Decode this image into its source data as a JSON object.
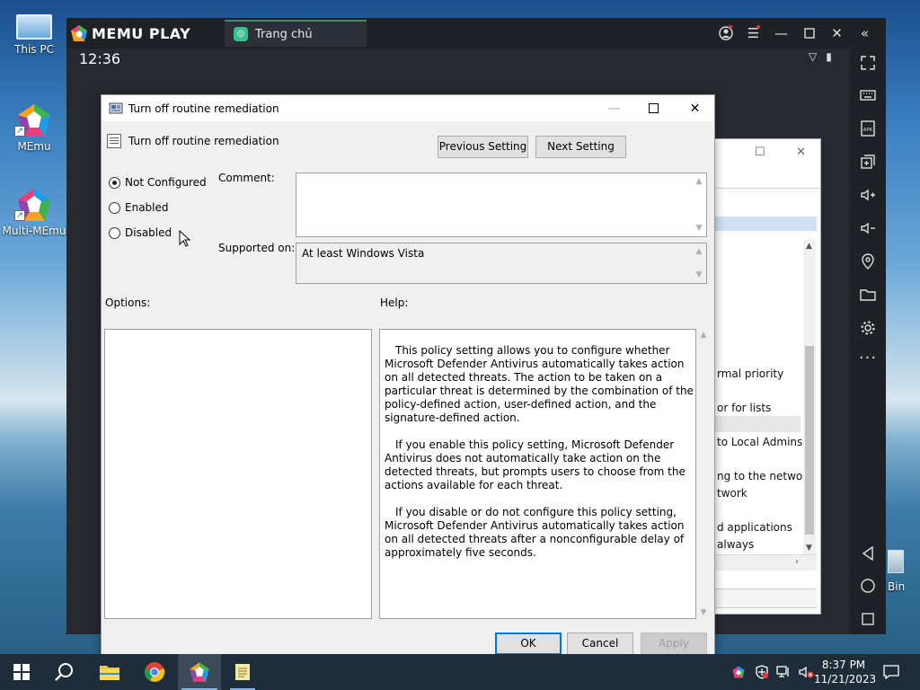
{
  "desktop": {
    "icons": [
      {
        "label": "This PC"
      },
      {
        "label": "MEmu"
      },
      {
        "label": "Multi-MEmu"
      }
    ],
    "recycle_label": "Bin"
  },
  "memu": {
    "logo_text": "MEMU PLAY",
    "tab_label": "Trang chủ",
    "time": "12:36",
    "sidebar_icons": [
      "fullscreen-icon",
      "keyboard-icon",
      "apk-icon",
      "multi-window-icon",
      "volume-up-icon",
      "volume-down-icon",
      "location-icon",
      "folder-icon",
      "settings-icon",
      "more-icon",
      "back-icon",
      "home-icon",
      "recents-icon"
    ]
  },
  "background_window": {
    "items": [
      "rmal priority",
      "or for lists",
      "to Local Admins.",
      "ng to the netwo...",
      "twork",
      "d applications",
      "always"
    ]
  },
  "dialog": {
    "title": "Turn off routine remediation",
    "policy_name": "Turn off routine remediation",
    "prev_button": "Previous Setting",
    "next_button": "Next Setting",
    "radios": [
      {
        "label": "Not Configured",
        "checked": true
      },
      {
        "label": "Enabled",
        "checked": false
      },
      {
        "label": "Disabled",
        "checked": false
      }
    ],
    "comment_label": "Comment:",
    "comment_value": "",
    "supported_label": "Supported on:",
    "supported_value": "At least Windows Vista",
    "options_label": "Options:",
    "help_label": "Help:",
    "help_paragraphs": [
      "This policy setting allows you to configure whether Microsoft Defender Antivirus automatically takes action on all detected threats. The action to be taken on a particular threat is determined by the combination of the policy-defined action, user-defined action, and the signature-defined action.",
      "If you enable this policy setting, Microsoft Defender Antivirus does not automatically take action on the detected threats, but prompts users to choose from the actions available for each threat.",
      "If you disable or do not configure this policy setting, Microsoft Defender Antivirus automatically takes action on all detected threats after a nonconfigurable delay of approximately five seconds."
    ],
    "ok_button": "OK",
    "cancel_button": "Cancel",
    "apply_button": "Apply"
  },
  "taskbar": {
    "time": "8:37 PM",
    "date": "11/21/2023"
  }
}
